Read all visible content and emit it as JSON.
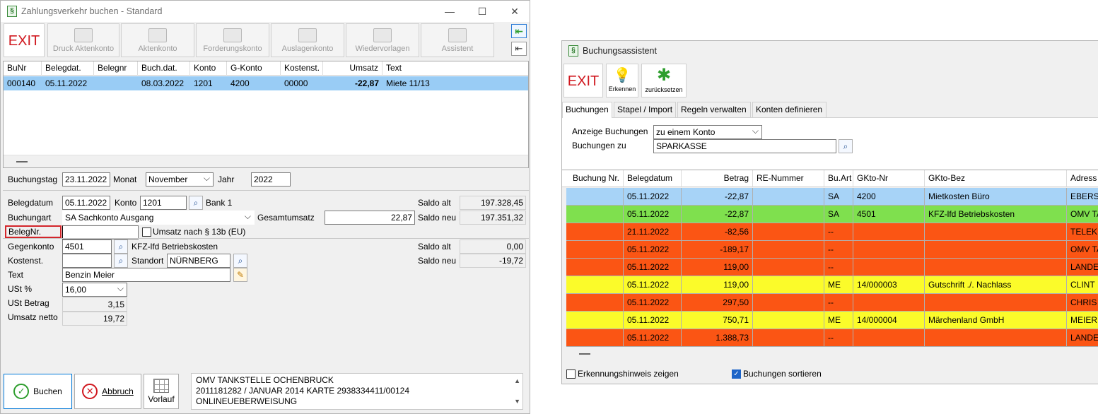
{
  "win1": {
    "title": "Zahlungsverkehr buchen - Standard",
    "toolbar": {
      "exit": "EXIT",
      "druck": "Druck Aktenkonto",
      "aktenkonto": "Aktenkonto",
      "forderungskonto": "Forderungskonto",
      "auslagenkonto": "Auslagenkonto",
      "wiedervorlagen": "Wiedervorlagen",
      "assistent": "Assistent"
    },
    "table": {
      "headers": [
        "BuNr",
        "Belegdat.",
        "Belegnr",
        "Buch.dat.",
        "Konto",
        "G-Konto",
        "Kostenst.",
        "Umsatz",
        "Text"
      ],
      "row": [
        "000140",
        "05.11.2022",
        "",
        "08.03.2022",
        "1201",
        "4200",
        "00000",
        "-22,87",
        "Miete 11/13"
      ]
    },
    "form": {
      "buchungstag_label": "Buchungstag",
      "buchungstag": "23.11.2022",
      "monat_label": "Monat",
      "monat": "November",
      "jahr_label": "Jahr",
      "jahr": "2022",
      "belegdatum_label": "Belegdatum",
      "belegdatum": "05.11.2022",
      "konto_label": "Konto",
      "konto": "1201",
      "konto_name": "Bank 1",
      "saldo_alt_label": "Saldo alt",
      "saldo_alt": "197.328,45",
      "buchungart_label": "Buchungart",
      "buchungart": "SA Sachkonto Ausgang",
      "gesamtumsatz_label": "Gesamtumsatz",
      "gesamtumsatz": "22,87",
      "saldo_neu_label": "Saldo neu",
      "saldo_neu": "197.351,32",
      "belegnr_label": "BelegNr.",
      "belegnr": "",
      "umsatz13b_label": "Umsatz nach § 13b (EU)",
      "gegenkonto_label": "Gegenkonto",
      "gegenkonto": "4501",
      "gegenkonto_name": "KFZ-lfd Betriebskosten",
      "saldo_alt2_label": "Saldo alt",
      "saldo_alt2": "0,00",
      "kostenst_label": "Kostenst.",
      "kostenst": "",
      "standort_label": "Standort",
      "standort": "NÜRNBERG",
      "saldo_neu2_label": "Saldo neu",
      "saldo_neu2": "-19,72",
      "text_label": "Text",
      "text": "Benzin Meier",
      "ust_label": "USt %",
      "ust": "16,00",
      "ustbetrag_label": "USt Betrag",
      "ustbetrag": "3,15",
      "netto_label": "Umsatz netto",
      "netto": "19,72"
    },
    "buttons": {
      "buchen": "Buchen",
      "abbruch": "Abbruch",
      "vorlauf": "Vorlauf"
    },
    "memo": [
      "OMV TANKSTELLE OCHENBRUCK",
      "2011181282 / JANUAR 2014  KARTE 2938334411/00124",
      "ONLINEUEBERWEISUNG"
    ]
  },
  "win2": {
    "title": "Buchungsassistent",
    "toolbar": {
      "exit": "EXIT",
      "erkennen": "Erkennen",
      "zuruecksetzen": "zurücksetzen"
    },
    "tabs": [
      "Buchungen",
      "Stapel / Import",
      "Regeln verwalten",
      "Konten definieren"
    ],
    "anzeige_label": "Anzeige Buchungen",
    "anzeige": "zu einem Konto",
    "buchungen_zu_label": "Buchungen zu",
    "buchungen_zu": "SPARKASSE",
    "headers": [
      "Buchung Nr.",
      "Belegdatum",
      "Betrag",
      "RE-Nummer",
      "Bu.Art",
      "GKto-Nr",
      "GKto-Bez",
      "Adress"
    ],
    "rows": [
      {
        "color": "#a7d3f7",
        "cells": [
          "",
          "05.11.2022",
          "-22,87",
          "",
          "SA",
          "4200",
          "Mietkosten Büro",
          "EBERS"
        ]
      },
      {
        "color": "#7fe04e",
        "cells": [
          "",
          "05.11.2022",
          "-22,87",
          "",
          "SA",
          "4501",
          "KFZ-lfd Betriebskosten",
          "OMV TA"
        ]
      },
      {
        "color": "#fb5514",
        "cells": [
          "",
          "21.11.2022",
          "-82,56",
          "",
          "--",
          "",
          "",
          "TELEK"
        ]
      },
      {
        "color": "#fb5514",
        "cells": [
          "",
          "05.11.2022",
          "-189,17",
          "",
          "--",
          "",
          "",
          "OMV TA"
        ]
      },
      {
        "color": "#fb5514",
        "cells": [
          "",
          "05.11.2022",
          "119,00",
          "",
          "--",
          "",
          "",
          "LANDE"
        ]
      },
      {
        "color": "#fbfb2a",
        "cells": [
          "",
          "05.11.2022",
          "119,00",
          "",
          "ME",
          "14/000003",
          "Gutschrift ./. Nachlass",
          "CLINT"
        ]
      },
      {
        "color": "#fb5514",
        "cells": [
          "",
          "05.11.2022",
          "297,50",
          "",
          "--",
          "",
          "",
          "CHRIS"
        ]
      },
      {
        "color": "#fbfb2a",
        "cells": [
          "",
          "05.11.2022",
          "750,71",
          "",
          "ME",
          "14/000004",
          "Märchenland GmbH",
          "MEIER"
        ]
      },
      {
        "color": "#fb5514",
        "cells": [
          "",
          "05.11.2022",
          "1.388,73",
          "",
          "--",
          "",
          "",
          "LANDE"
        ]
      }
    ],
    "chk_erkennung": "Erkennungshinweis zeigen",
    "chk_sortieren": "Buchungen sortieren"
  }
}
